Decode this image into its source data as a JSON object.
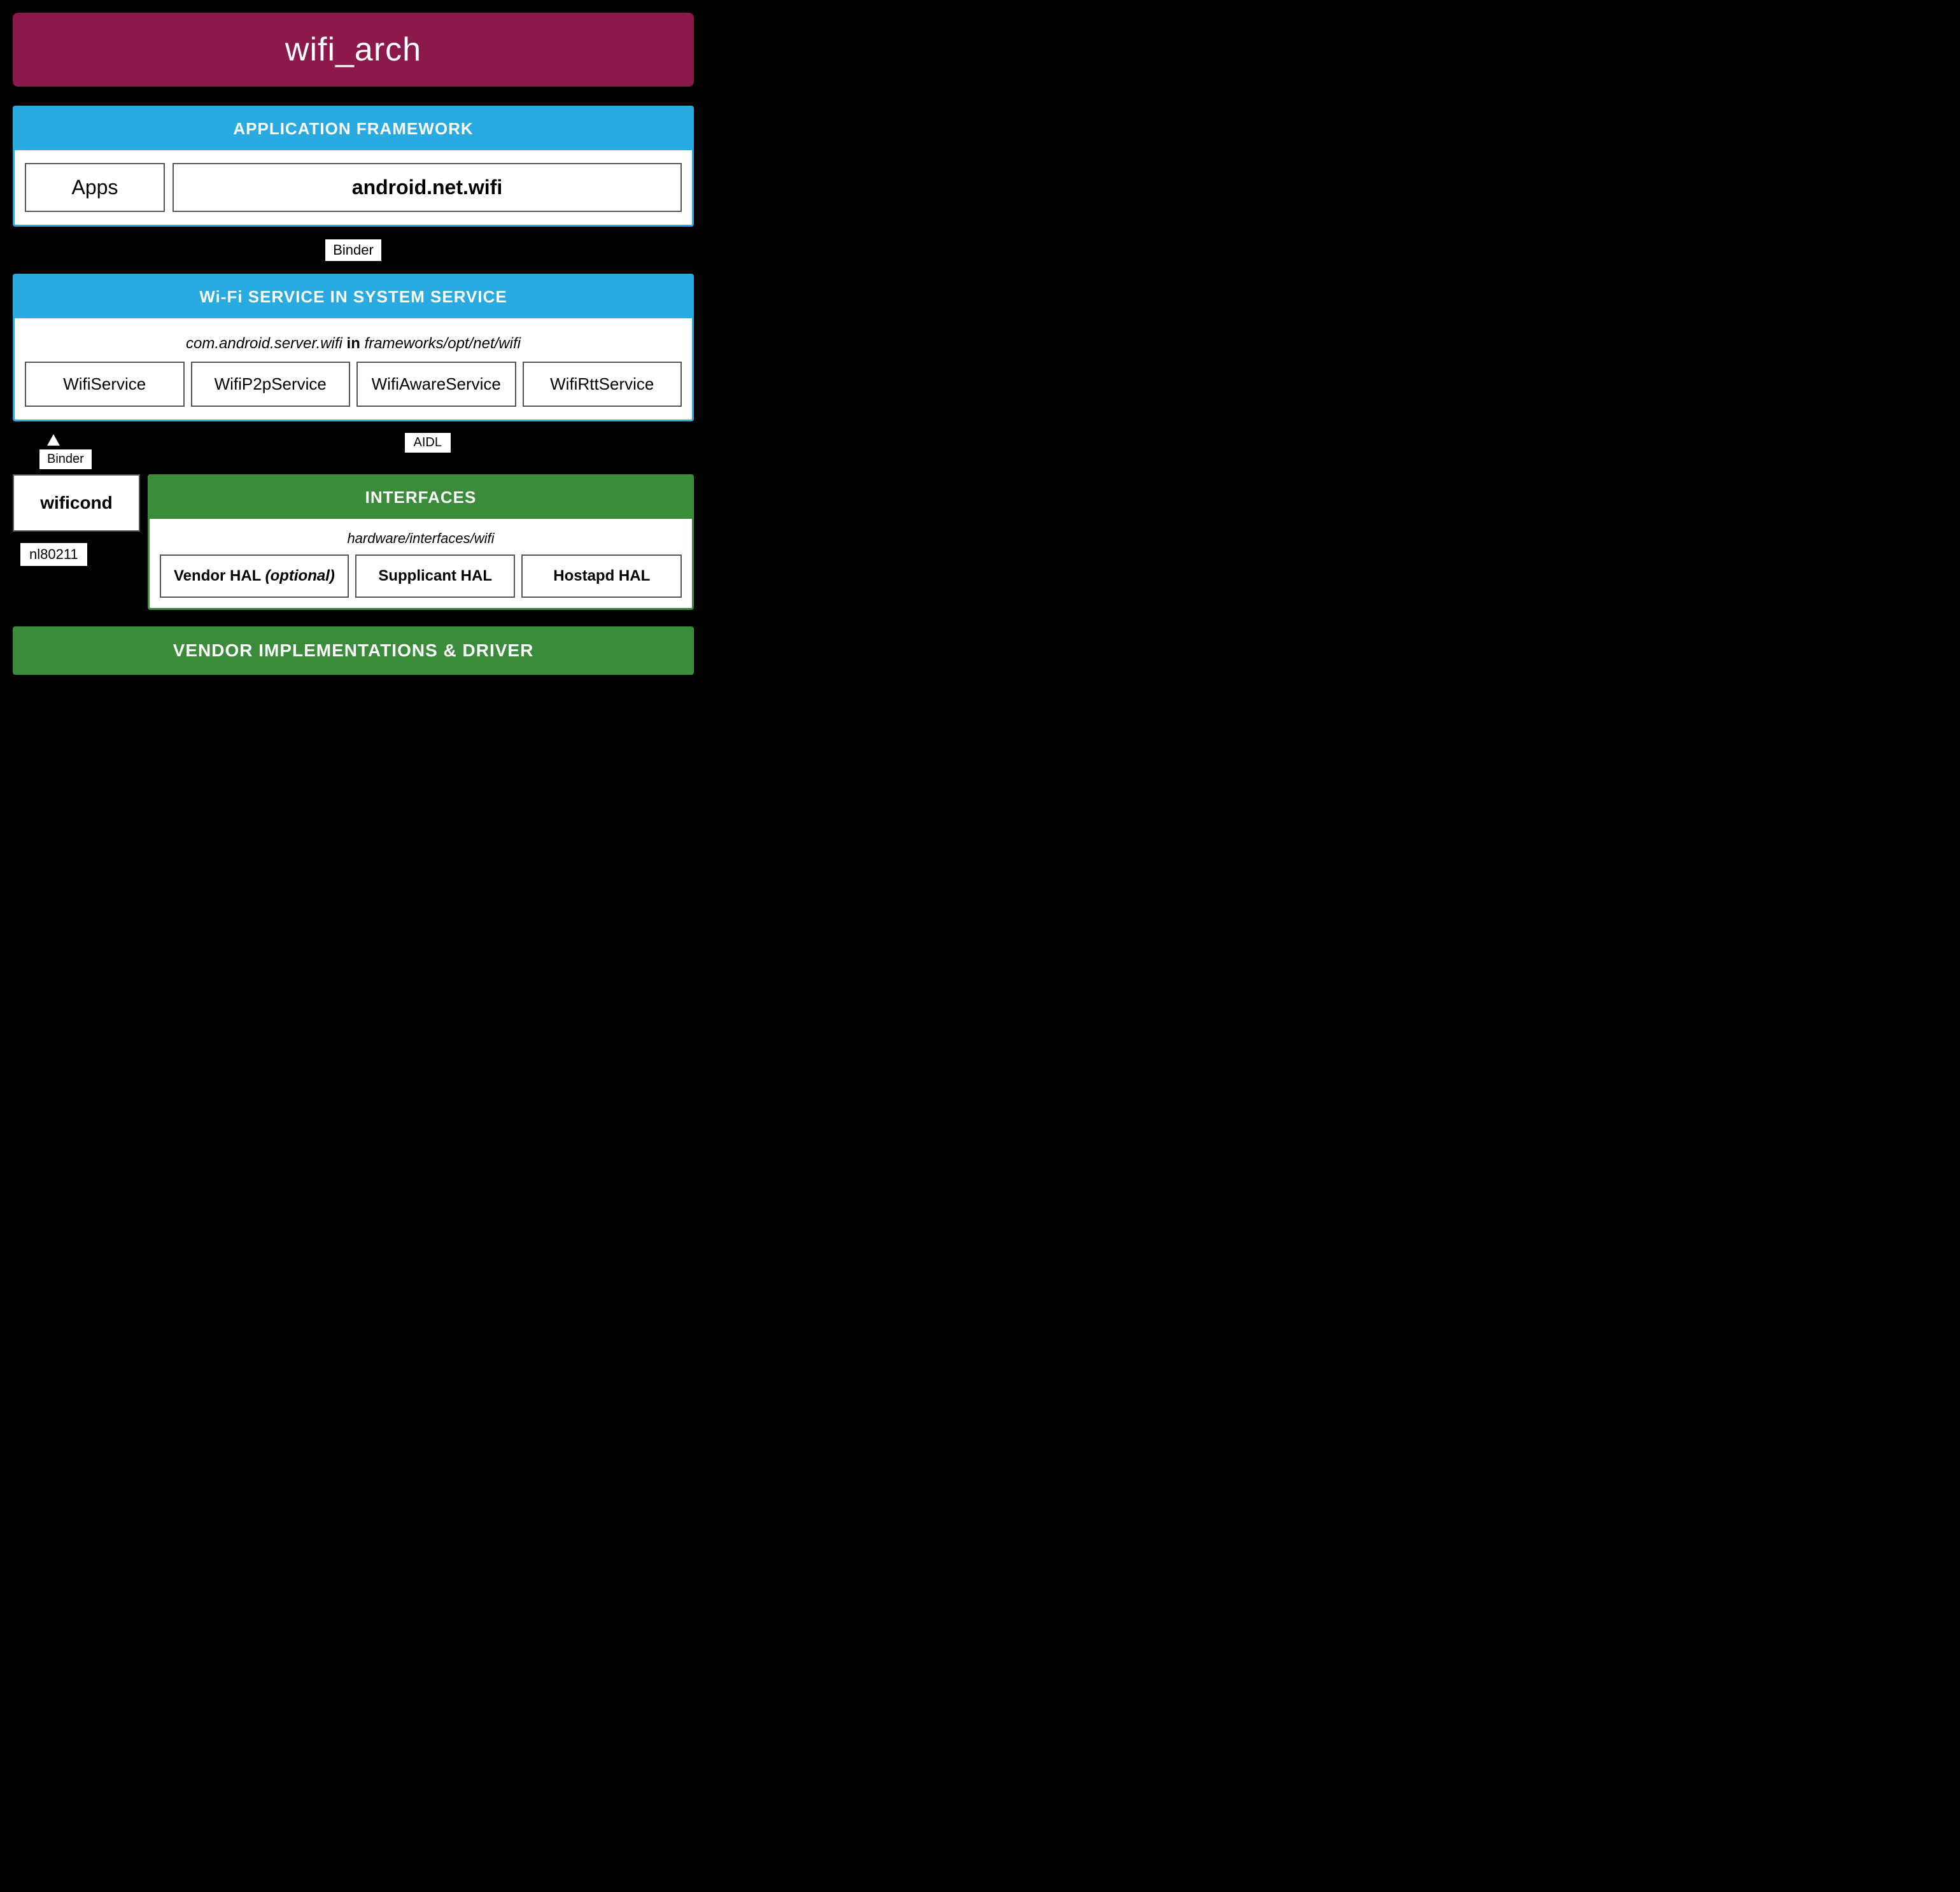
{
  "title": "wifi_arch",
  "sections": {
    "app_framework": {
      "header": "APPLICATION FRAMEWORK",
      "apps_label": "Apps",
      "android_net_wifi_label": "android.net.wifi"
    },
    "binder_center": "Binder",
    "wifi_service": {
      "header": "Wi-Fi SERVICE IN SYSTEM SERVICE",
      "subtitle_italic": "com.android.server.wifi",
      "subtitle_strong": "in",
      "subtitle_path": "frameworks/opt/net/wifi",
      "services": [
        "WifiService",
        "WifiP2pService",
        "WifiAwareService",
        "WifiRttService"
      ]
    },
    "binder_left": "Binder",
    "aidl_label": "AIDL",
    "wificond_label": "wificond",
    "interfaces": {
      "header": "INTERFACES",
      "subtitle": "hardware/interfaces/wifi",
      "items": [
        "Vendor HAL (optional)",
        "Supplicant HAL",
        "Hostapd HAL"
      ]
    },
    "nl80211_label": "nl80211",
    "vendor_bar": "VENDOR IMPLEMENTATIONS & DRIVER"
  }
}
